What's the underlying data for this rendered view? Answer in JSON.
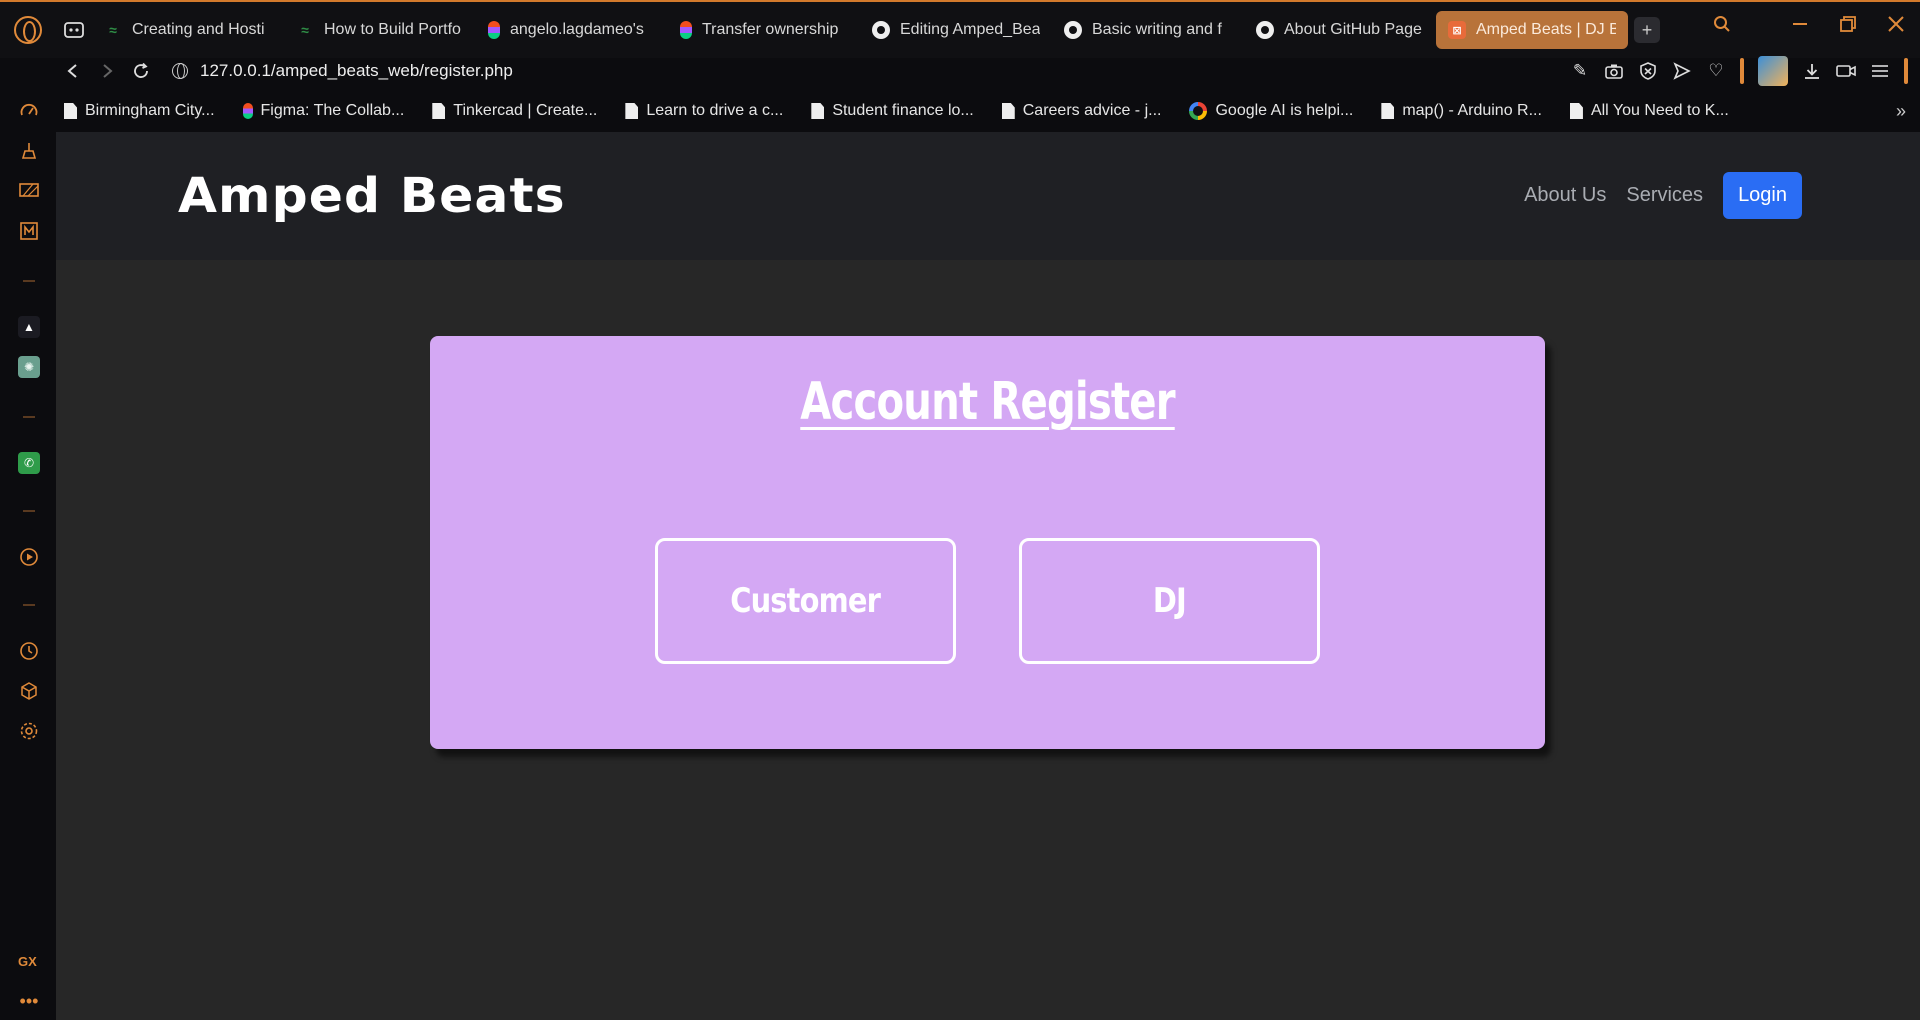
{
  "browser": {
    "tabs": [
      {
        "label": "Creating and Hosti",
        "icon": "gfg"
      },
      {
        "label": "How to Build Portfo",
        "icon": "gfg"
      },
      {
        "label": "angelo.lagdameo's",
        "icon": "figma"
      },
      {
        "label": "Transfer ownership",
        "icon": "figma"
      },
      {
        "label": "Editing Amped_Bea",
        "icon": "github"
      },
      {
        "label": "Basic writing and f",
        "icon": "github"
      },
      {
        "label": "About GitHub Page",
        "icon": "github"
      },
      {
        "label": "Amped Beats | DJ Booking",
        "icon": "amped",
        "active": true
      }
    ],
    "url": "127.0.0.1/amped_beats_web/register.php",
    "bookmarks": [
      {
        "label": "Birmingham City...",
        "icon": "doc"
      },
      {
        "label": "Figma: The Collab...",
        "icon": "figma"
      },
      {
        "label": "Tinkercad | Create...",
        "icon": "doc"
      },
      {
        "label": "Learn to drive a c...",
        "icon": "doc"
      },
      {
        "label": "Student finance lo...",
        "icon": "doc"
      },
      {
        "label": "Careers advice - j...",
        "icon": "doc"
      },
      {
        "label": "Google AI is helpi...",
        "icon": "google"
      },
      {
        "label": "map() - Arduino R...",
        "icon": "doc"
      },
      {
        "label": "All You Need to K...",
        "icon": "doc"
      }
    ],
    "sidebar_label": "GX",
    "accent_color": "#e08a3a"
  },
  "site": {
    "brand": "Amped Beats",
    "nav": {
      "about": "About Us",
      "services": "Services",
      "login": "Login"
    },
    "colors": {
      "nav_bg": "#1f2024",
      "page_bg": "#272727",
      "card_bg": "#d4a8f4",
      "login_bg": "#2a6df4"
    }
  },
  "register": {
    "title": "Account Register",
    "options": {
      "customer": "Customer",
      "dj": "DJ"
    }
  }
}
